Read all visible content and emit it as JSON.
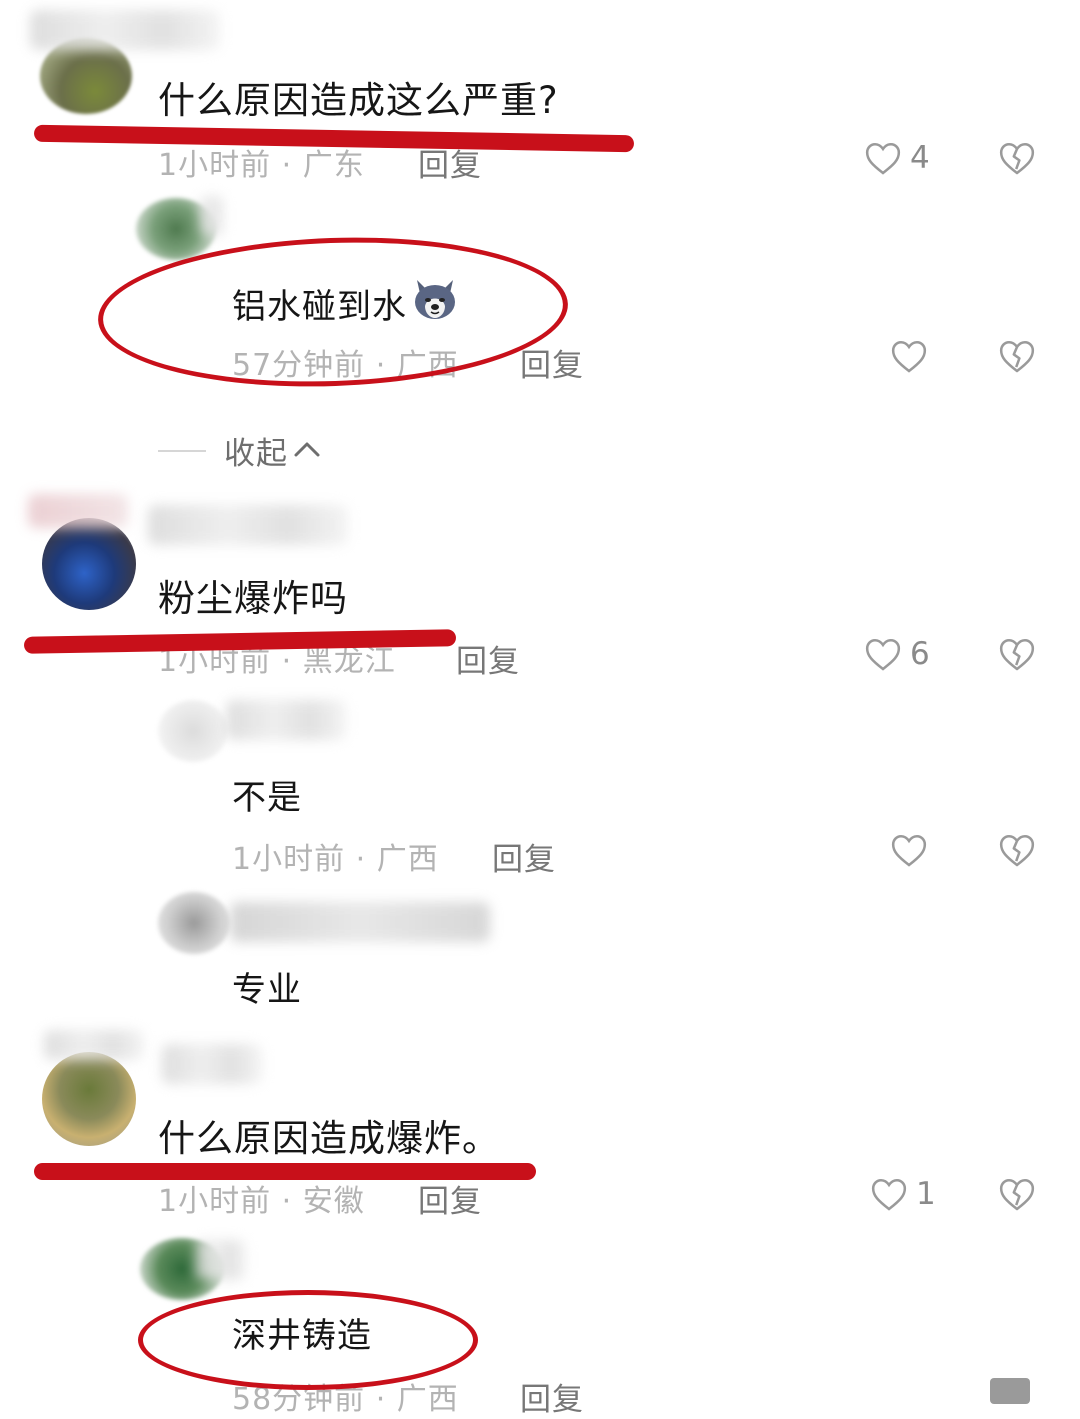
{
  "comments": [
    {
      "text": "什么原因造成这么严重?",
      "meta": "1小时前 · 广东",
      "reply_label": "回复",
      "likes": "4",
      "replies": [
        {
          "text": "铝水碰到水",
          "emoji": "dog-emoji",
          "meta": "57分钟前 · 广西",
          "reply_label": "回复"
        }
      ]
    },
    {
      "text": "粉尘爆炸吗",
      "meta": "1小时前 · 黑龙江",
      "reply_label": "回复",
      "likes": "6",
      "replies": [
        {
          "text": "不是",
          "meta": "1小时前 · 广西",
          "reply_label": "回复"
        },
        {
          "text": "专业"
        }
      ]
    },
    {
      "text": "什么原因造成爆炸。",
      "meta": "1小时前 · 安徽",
      "reply_label": "回复",
      "likes": "1",
      "replies": [
        {
          "text": "深井铸造",
          "meta": "58分钟前 · 广西",
          "reply_label": "回复"
        }
      ]
    }
  ],
  "collapse_label": "收起",
  "icons": {
    "like": "heart-outline-icon",
    "dislike": "broken-heart-icon",
    "collapse": "chevron-up-icon"
  },
  "colors": {
    "annotation": "#c8101a",
    "meta_text": "#b3b3b3",
    "body_text": "#161616"
  }
}
